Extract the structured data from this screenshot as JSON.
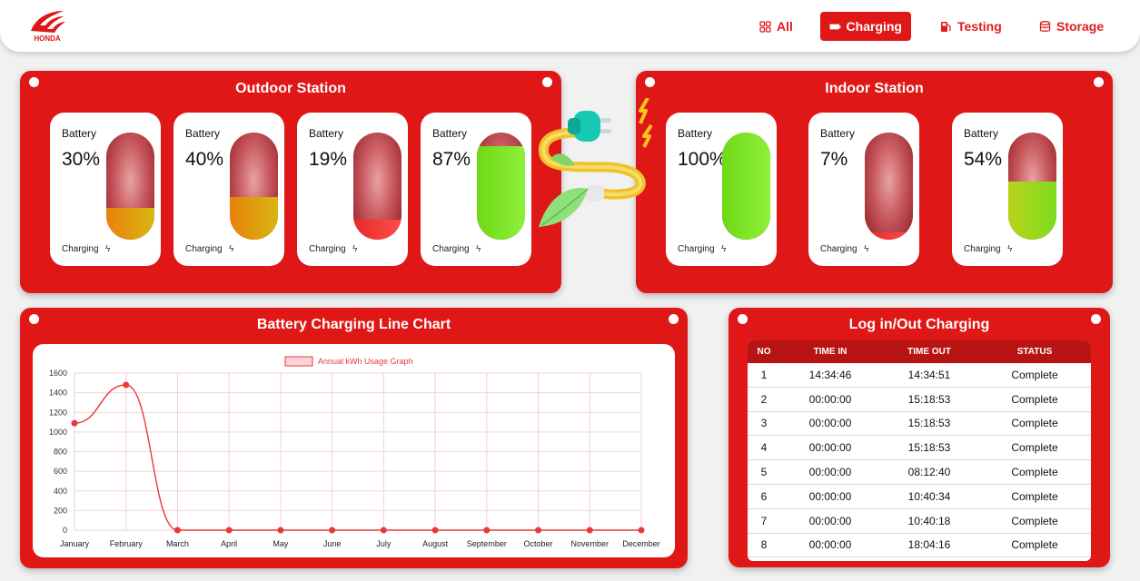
{
  "nav": {
    "all": "All",
    "charging": "Charging",
    "testing": "Testing",
    "storage": "Storage"
  },
  "outdoor": {
    "title": "Outdoor Station",
    "batteries": [
      {
        "label": "Battery",
        "percent": "30%",
        "level": 30,
        "status": "Charging"
      },
      {
        "label": "Battery",
        "percent": "40%",
        "level": 40,
        "status": "Charging"
      },
      {
        "label": "Battery",
        "percent": "19%",
        "level": 19,
        "status": "Charging"
      },
      {
        "label": "Battery",
        "percent": "87%",
        "level": 87,
        "status": "Charging"
      }
    ]
  },
  "indoor": {
    "title": "Indoor Station",
    "batteries": [
      {
        "label": "Battery",
        "percent": "100%",
        "level": 100,
        "status": "Charging"
      },
      {
        "label": "Battery",
        "percent": "7%",
        "level": 7,
        "status": "Charging"
      },
      {
        "label": "Battery",
        "percent": "54%",
        "level": 54,
        "status": "Charging"
      }
    ]
  },
  "chart_panel": {
    "title": "Battery Charging Line Chart"
  },
  "chart_data": {
    "type": "line",
    "title": "",
    "categories": [
      "January",
      "February",
      "March",
      "April",
      "May",
      "June",
      "July",
      "August",
      "September",
      "October",
      "November",
      "December"
    ],
    "series": [
      {
        "name": "Annual kWh Usage Graph",
        "values": [
          1090,
          1480,
          0,
          0,
          0,
          0,
          0,
          0,
          0,
          0,
          0,
          0
        ]
      }
    ],
    "ylim": [
      0,
      1600
    ],
    "yticks": [
      0,
      200,
      400,
      600,
      800,
      1000,
      1200,
      1400,
      1600
    ],
    "grid": true,
    "legend": "top-center",
    "color": "#e8383d"
  },
  "log": {
    "title": "Log in/Out Charging",
    "headers": {
      "no": "NO",
      "time_in": "TIME IN",
      "time_out": "TIME OUT",
      "status": "STATUS"
    },
    "rows": [
      {
        "no": "1",
        "time_in": "14:34:46",
        "time_out": "14:34:51",
        "status": "Complete"
      },
      {
        "no": "2",
        "time_in": "00:00:00",
        "time_out": "15:18:53",
        "status": "Complete"
      },
      {
        "no": "3",
        "time_in": "00:00:00",
        "time_out": "15:18:53",
        "status": "Complete"
      },
      {
        "no": "4",
        "time_in": "00:00:00",
        "time_out": "15:18:53",
        "status": "Complete"
      },
      {
        "no": "5",
        "time_in": "00:00:00",
        "time_out": "08:12:40",
        "status": "Complete"
      },
      {
        "no": "6",
        "time_in": "00:00:00",
        "time_out": "10:40:34",
        "status": "Complete"
      },
      {
        "no": "7",
        "time_in": "00:00:00",
        "time_out": "10:40:18",
        "status": "Complete"
      },
      {
        "no": "8",
        "time_in": "00:00:00",
        "time_out": "18:04:16",
        "status": "Complete"
      }
    ]
  },
  "colors": {
    "brand_red": "#e01717",
    "fill_green": "#7ddc1f",
    "fill_orange": "#e8820e",
    "fill_red": "#e8383d"
  },
  "logo": {
    "text": "HONDA"
  }
}
